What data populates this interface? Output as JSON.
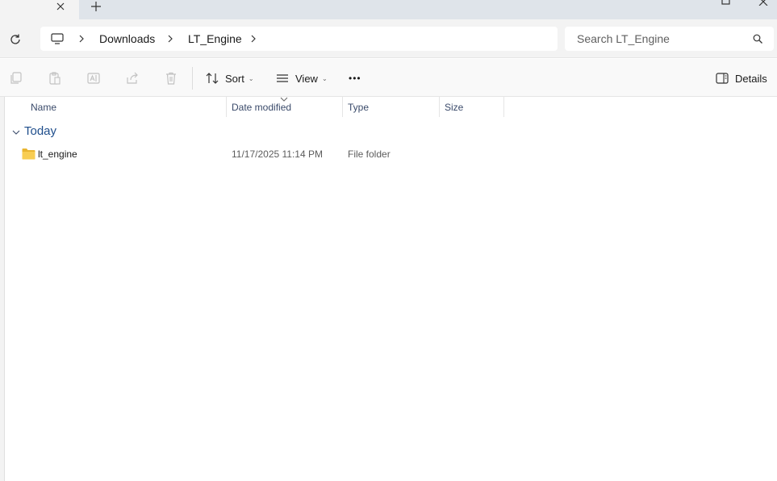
{
  "tabbar": {
    "close_icon": "close-icon",
    "new_tab_icon": "plus-icon"
  },
  "address": {
    "computer_icon": "monitor-icon",
    "breadcrumb": [
      "Downloads",
      "LT_Engine"
    ],
    "search_placeholder": "Search LT_Engine"
  },
  "commands": {
    "sort_label": "Sort",
    "view_label": "View",
    "more_label": "•••",
    "details_label": "Details"
  },
  "columns": {
    "name": "Name",
    "date_modified": "Date modified",
    "type": "Type",
    "size": "Size"
  },
  "group": {
    "title": "Today"
  },
  "files": [
    {
      "name": "lt_engine",
      "date_modified": "11/17/2025 11:14 PM",
      "type": "File folder",
      "size": ""
    }
  ],
  "colors": {
    "accent": "#1f4e8c",
    "folder": "#f5c542"
  }
}
